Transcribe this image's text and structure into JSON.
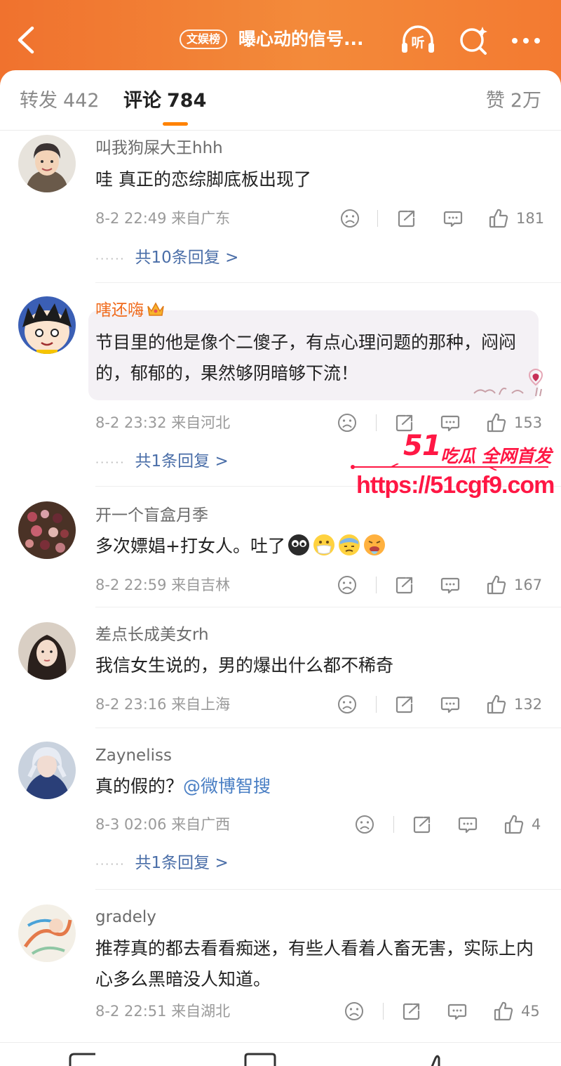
{
  "header": {
    "badge": "文娱榜",
    "title": "曝心动的信号...",
    "listen_label": "听",
    "accent_color": "#f37a31"
  },
  "tabs": {
    "forward": {
      "label": "转发",
      "count": "442"
    },
    "comments": {
      "label": "评论",
      "count": "784"
    },
    "likes": {
      "label": "赞",
      "count": "2万"
    }
  },
  "comments": [
    {
      "username": "叫我狗屎大王hhh",
      "text": "哇 真正的恋综脚底板出现了",
      "time": "8-2 22:49",
      "location": "来自广东",
      "likes": "181",
      "replies": "共10条回复 >"
    },
    {
      "username": "嗐还嗨",
      "text": "节目里的他是像个二傻子，有点心理问题的那种，闷闷的，郁郁的，果然够阴暗够下流！",
      "time": "8-2 23:32",
      "location": "来自河北",
      "likes": "153",
      "replies": "共1条回复 >"
    },
    {
      "username": "开一个盲盒月季",
      "text": "多次嫖娼+打女人。吐了",
      "time": "8-2 22:59",
      "location": "来自吉林",
      "likes": "167"
    },
    {
      "username": "差点长成美女rh",
      "text": "我信女生说的，男的爆出什么都不稀奇",
      "time": "8-2 23:16",
      "location": "来自上海",
      "likes": "132"
    },
    {
      "username": "Zayneliss",
      "text": "真的假的？",
      "mention": "@微博智搜",
      "time": "8-3 02:06",
      "location": "来自广西",
      "likes": "4",
      "replies": "共1条回复 >"
    },
    {
      "username": "gradely",
      "text": "推荐真的都去看看痴迷，有些人看着人畜无害，实际上内心多么黑暗没人知道。",
      "time": "8-2 22:51",
      "location": "来自湖北",
      "likes": "45"
    }
  ],
  "watermark": {
    "brand": "51",
    "slogan": "吃瓜 全网首发",
    "url": "https://51cgf9.com",
    "color": "#ff1744"
  },
  "icons": {
    "back": "chevron-left-icon",
    "listen": "headphones-icon",
    "search": "search-sparkle-icon",
    "more": "more-dots-icon",
    "dislike": "frown-face-icon",
    "share": "share-icon",
    "reply": "comment-icon",
    "like": "thumbs-up-icon"
  }
}
